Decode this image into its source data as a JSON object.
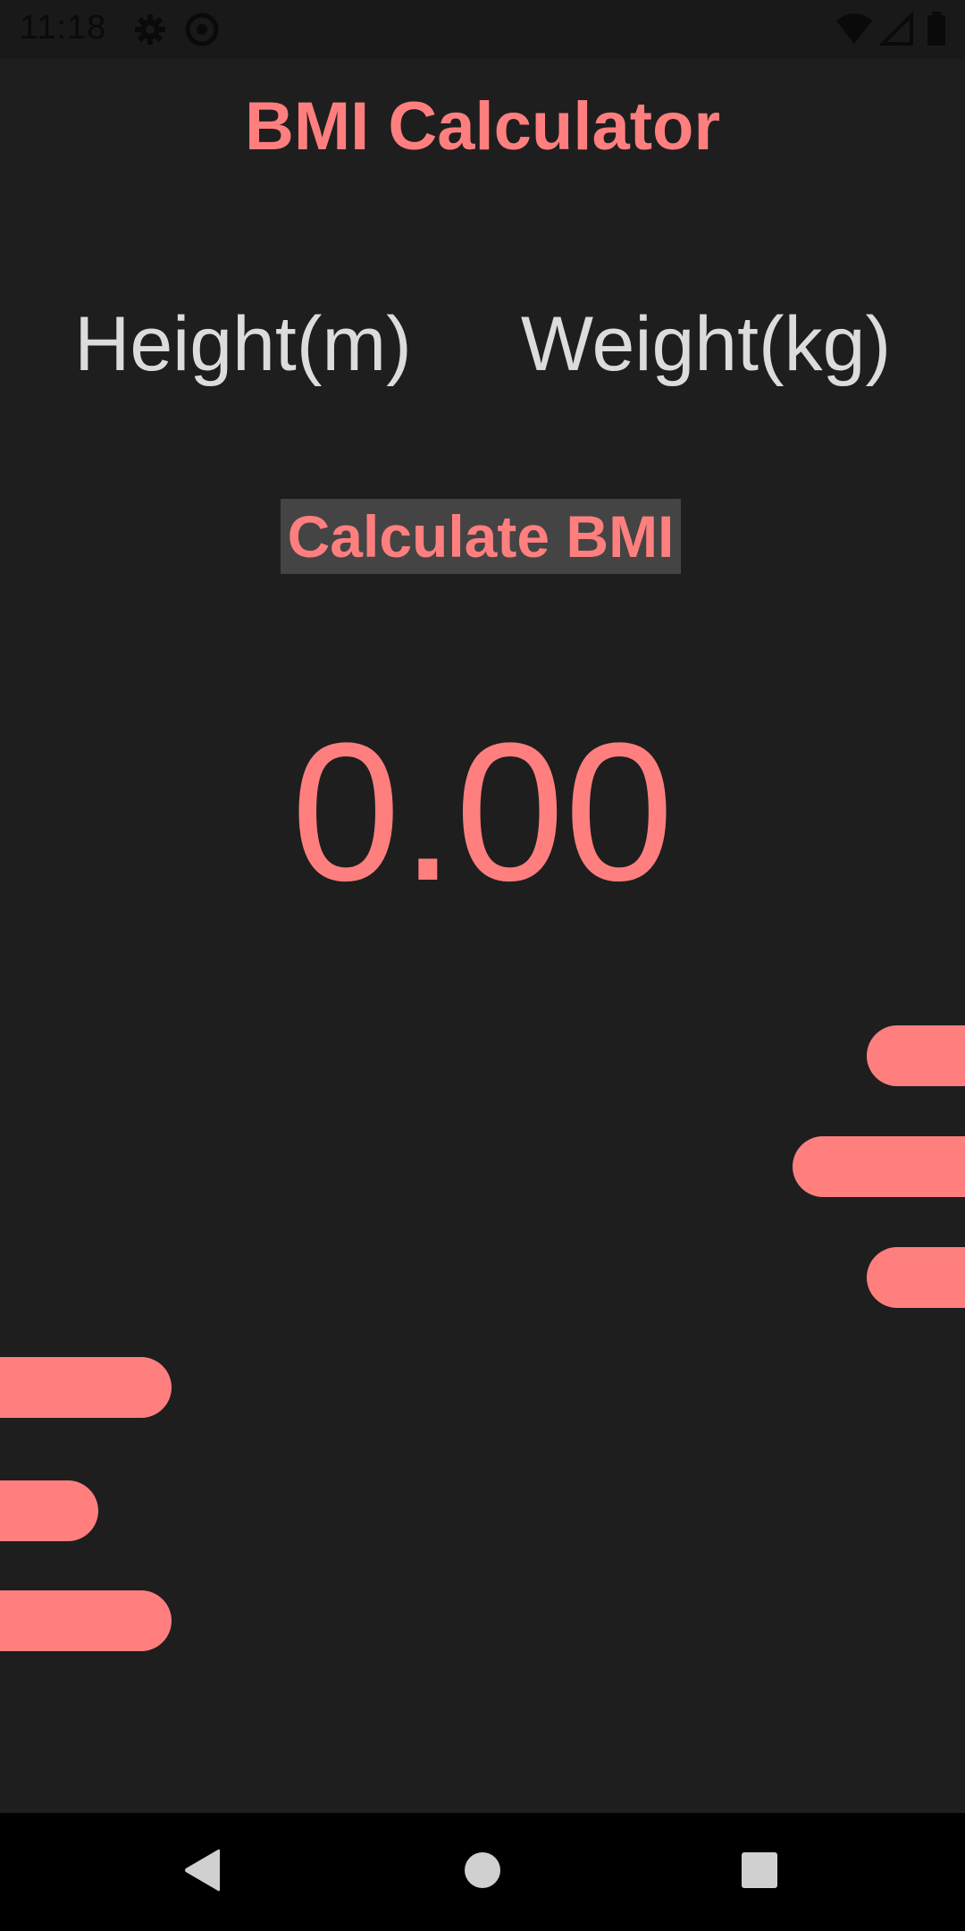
{
  "status_bar": {
    "time": "11:18",
    "icons": [
      "settings-icon",
      "data-saver-icon",
      "wifi-icon",
      "signal-icon",
      "battery-icon"
    ]
  },
  "app": {
    "title": "BMI Calculator",
    "height_placeholder": "Height(m)",
    "height_value": "",
    "weight_placeholder": "Weight(kg)",
    "weight_value": "",
    "calculate_label": "Calculate BMI",
    "result": "0.00"
  },
  "navigation": {
    "buttons": [
      "back-icon",
      "home-icon",
      "recents-icon"
    ]
  },
  "colors": {
    "background": "#1e1e1e",
    "accent": "#ff7f7f",
    "input_text": "#dcdcdc",
    "button_bg": "#444444",
    "status_bar": "#191919",
    "nav_bar": "#000000"
  }
}
